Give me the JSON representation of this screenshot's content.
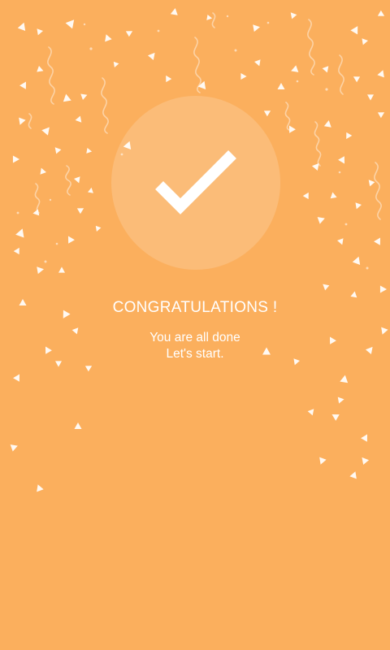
{
  "screen": {
    "background_color": "#FBAF5D",
    "foreground_color": "#FFFFFF"
  },
  "success_badge": {
    "icon": "checkmark-icon"
  },
  "message": {
    "title": "CONGRATULATIONS !",
    "line1": "You are all done",
    "line2": "Let's start."
  },
  "decoration": {
    "confetti_icon": "confetti-triangle-icon",
    "streamer_icon": "ribbon-streamer-icon"
  }
}
